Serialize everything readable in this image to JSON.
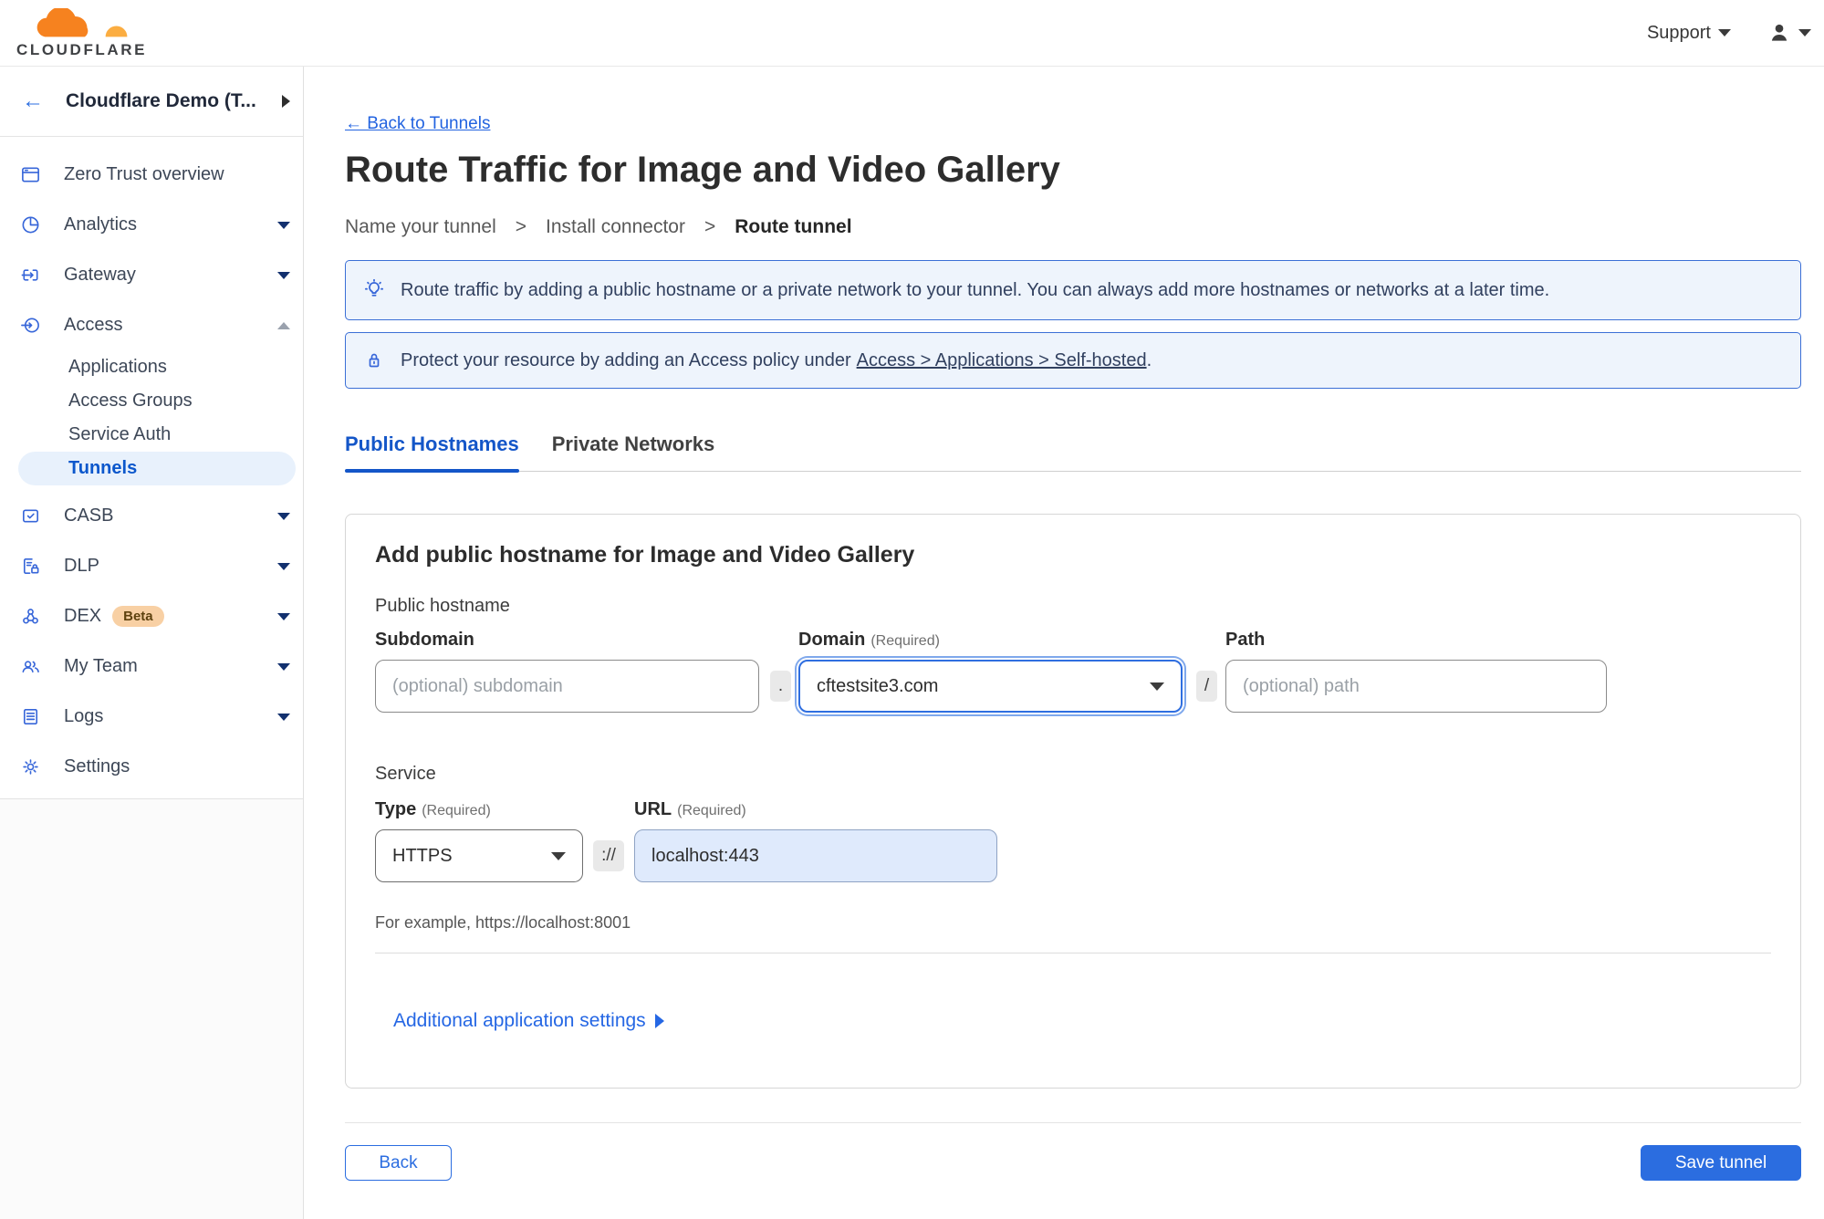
{
  "topbar": {
    "brand": "CLOUDFLARE",
    "support_label": "Support"
  },
  "sidebar": {
    "back_arrow": "←",
    "account_name": "Cloudflare Demo (T...",
    "items": [
      {
        "label": "Zero Trust overview"
      },
      {
        "label": "Analytics"
      },
      {
        "label": "Gateway"
      },
      {
        "label": "Access"
      },
      {
        "label": "CASB"
      },
      {
        "label": "DLP"
      },
      {
        "label": "DEX",
        "badge": "Beta"
      },
      {
        "label": "My Team"
      },
      {
        "label": "Logs"
      },
      {
        "label": "Settings"
      }
    ],
    "access_children": [
      {
        "label": "Applications"
      },
      {
        "label": "Access Groups"
      },
      {
        "label": "Service Auth"
      },
      {
        "label": "Tunnels"
      }
    ]
  },
  "page": {
    "back_link": "← Back to Tunnels",
    "title": "Route Traffic for Image and Video Gallery",
    "breadcrumb": {
      "step1": "Name your tunnel",
      "separator": ">",
      "step2": "Install connector",
      "step3": "Route tunnel"
    },
    "banners": {
      "tip": "Route traffic by adding a public hostname or a private network to your tunnel. You can always add more hostnames or networks at a later time.",
      "access_prefix": "Protect your resource by adding an Access policy under",
      "access_link": "Access > Applications > Self-hosted",
      "access_suffix": "."
    },
    "tabs": {
      "public_hostnames": "Public Hostnames",
      "private_networks": "Private Networks"
    },
    "form": {
      "heading": "Add public hostname for Image and Video Gallery",
      "group_label": "Public hostname",
      "required_hint": "(Required)",
      "subdomain_label": "Subdomain",
      "subdomain_placeholder": "(optional) subdomain",
      "dot_separator": ".",
      "domain_label": "Domain",
      "domain_value": "cftestsite3.com",
      "slash_separator": "/",
      "path_label": "Path",
      "path_placeholder": "(optional) path",
      "service_label": "Service",
      "type_label": "Type",
      "type_value": "HTTPS",
      "scheme_separator": "://",
      "url_label": "URL",
      "url_value": "localhost:443",
      "example_text": "For example, https://localhost:8001",
      "additional_settings": "Additional application settings"
    },
    "footer": {
      "back_button": "Back",
      "save_button": "Save tunnel"
    }
  },
  "colors": {
    "accent_blue": "#2b6de0",
    "tab_active_blue": "#1456c8",
    "banner_bg": "#eef4fc",
    "banner_border": "#3b6fd6",
    "banner_text": "#31405f",
    "selected_pill_bg": "#e8f1fc",
    "selected_pill_text": "#0b57cc",
    "beta_badge_bg": "#f8d0a4",
    "url_input_bg": "#dfeafc",
    "brand_orange": "#f6821f",
    "brand_orange_light": "#fbad41"
  }
}
